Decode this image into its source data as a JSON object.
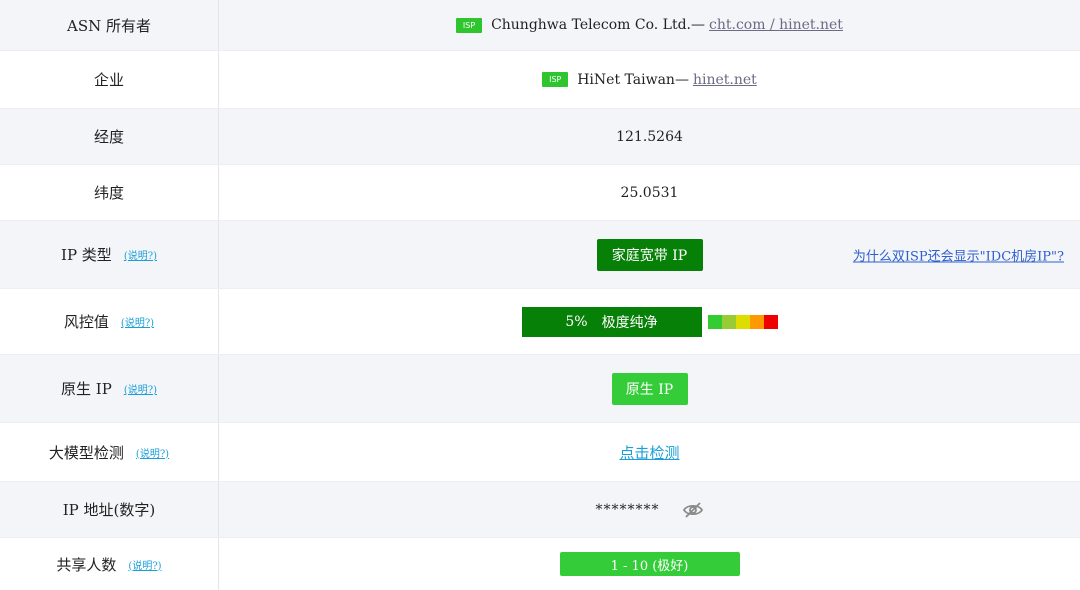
{
  "rows": [
    {
      "label": "ASN 所有者",
      "badge": "ISP",
      "name": "Chunghwa Telecom Co. Ltd.—",
      "link": "cht.com / hinet.net"
    },
    {
      "label": "企业",
      "badge": "ISP",
      "name": "HiNet Taiwan—",
      "link": "hinet.net"
    },
    {
      "label": "经度",
      "value": "121.5264"
    },
    {
      "label": "纬度",
      "value": "25.0531"
    },
    {
      "label": "IP 类型",
      "explain": "(说明?)",
      "value": "家庭宽带 IP",
      "side_link": "为什么双ISP还会显示\"IDC机房IP\"?"
    },
    {
      "label": "风控值",
      "explain": "(说明?)",
      "percent": "5%",
      "status": "极度纯净",
      "risk_level": 0.05,
      "scale_colors": [
        "#33cc33",
        "#99cc33",
        "#dddd00",
        "#ff9900",
        "#ee0000"
      ]
    },
    {
      "label": "原生 IP",
      "explain": "(说明?)",
      "value": "原生 IP"
    },
    {
      "label": "大模型检测",
      "explain": "(说明?)",
      "link": "点击检测"
    },
    {
      "label": "IP 地址(数字)",
      "value": "********",
      "icon": "eye-off-icon"
    },
    {
      "label": "共享人数",
      "explain": "(说明?)",
      "value": "1 - 10 (极好)"
    }
  ],
  "colors": {
    "isp_badge": "#2ec52e",
    "dark_green": "#078007",
    "light_green": "#35cc3a",
    "link_blue": "#1a9fd8",
    "side_link_blue": "#2d5fcf"
  }
}
